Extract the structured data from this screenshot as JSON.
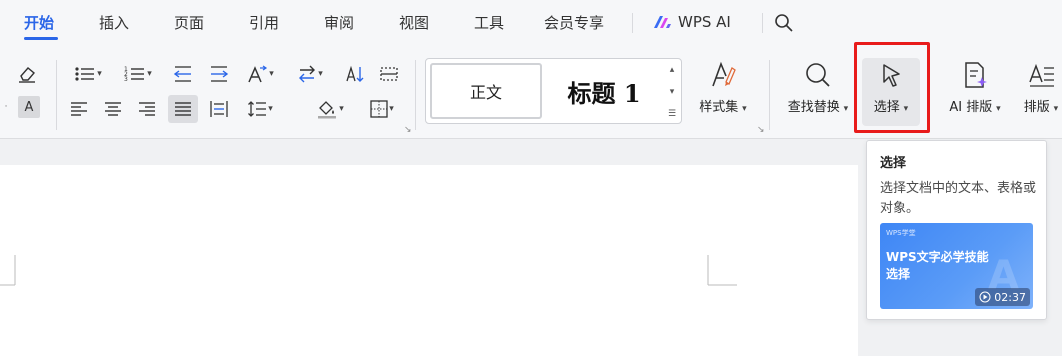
{
  "tabs": [
    {
      "label": "开始",
      "active": true
    },
    {
      "label": "插入"
    },
    {
      "label": "页面"
    },
    {
      "label": "引用"
    },
    {
      "label": "审阅"
    },
    {
      "label": "视图"
    },
    {
      "label": "工具"
    },
    {
      "label": "会员专享"
    }
  ],
  "wps_ai": {
    "label": "WPS AI"
  },
  "ribbon": {
    "style_gallery": {
      "normal": "正文",
      "heading1": "标题  1"
    },
    "styles_label": "样式集",
    "find_replace_label": "查找替换",
    "select_label": "选择",
    "ai_layout_label": "AI 排版",
    "layout_label": "排版"
  },
  "tooltip": {
    "title": "选择",
    "description": "选择文档中的文本、表格或对象。",
    "video": {
      "brand": "WPS学堂",
      "title": "WPS文字必学技能 选择",
      "duration": "02:37"
    }
  },
  "colors": {
    "accent": "#2b66e8",
    "highlight_box": "#e81b1b",
    "video_bg": "#3e86f5"
  }
}
